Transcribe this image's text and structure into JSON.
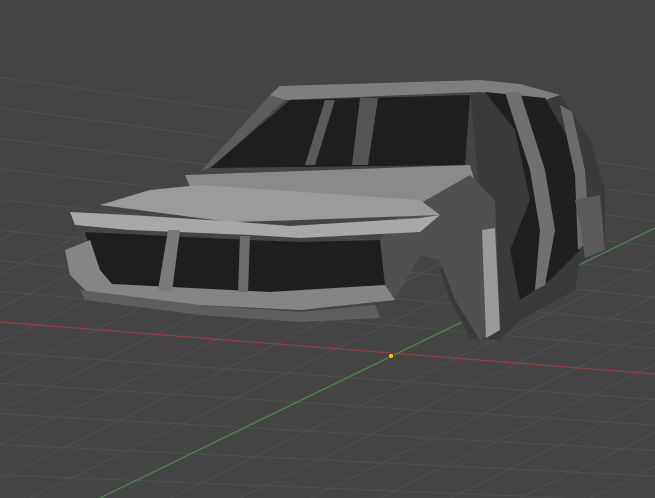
{
  "viewport": {
    "background_color": "#444444",
    "grid_color": "#505050",
    "x_axis_color": "#9b3a42",
    "y_axis_color": "#4e8a4e",
    "origin_color": "#f5b800"
  },
  "model": {
    "body_light": "#8c8c8c",
    "body_mid": "#6a6a6a",
    "body_dark": "#2a2a2a",
    "interior": "#1c1c1c"
  }
}
